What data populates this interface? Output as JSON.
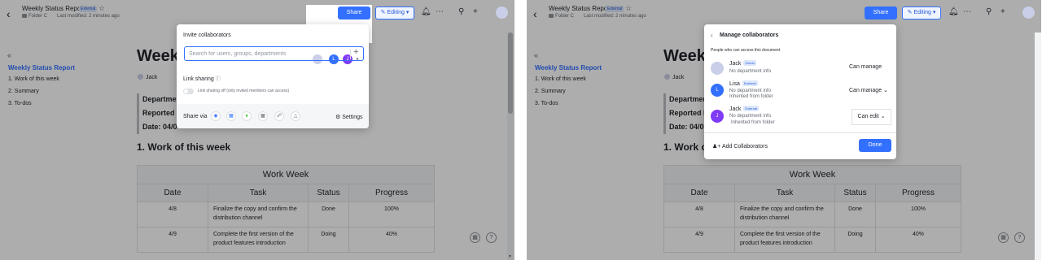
{
  "header": {
    "doc_title": "Weekly Status Report",
    "external_tag": "External",
    "folder": "Folder C",
    "last_modified": "Last modified: 2 minutes ago",
    "share_label": "Share",
    "editing_label": "Editing"
  },
  "toc": {
    "title": "Weekly Status Report",
    "items": [
      "1. Work of this week",
      "2. Summary",
      "3. To-dos"
    ]
  },
  "doc": {
    "big_title": "Week",
    "author": "Jack",
    "meta": [
      "Departmen",
      "Reported b",
      "Date: 04/0"
    ],
    "meta_right": [
      "Departmen",
      "Reported b",
      "Date: 04/0"
    ],
    "section_heading": "1. Work of this week",
    "section_heading_right": "1. Work o",
    "table": {
      "title": "Work Week",
      "headers": [
        "Date",
        "Task",
        "Status",
        "Progress"
      ],
      "rows": [
        [
          "4/8",
          "Finalize the copy and confirm the distribution channel",
          "Done",
          "100%"
        ],
        [
          "4/9",
          "Complete the first version of the product features introduction",
          "Doing",
          "40%"
        ]
      ]
    }
  },
  "invite": {
    "title": "Invite collaborators",
    "search_placeholder": "Search for users, groups, departments",
    "link_sharing": "Link sharing",
    "link_sharing_status": "Link sharing off (only invited members can access)",
    "share_via": "Share via",
    "settings": "Settings",
    "avatars": [
      "L",
      "J"
    ]
  },
  "manage": {
    "title": "Manage collaborators",
    "subtitle": "People who can access this document",
    "people": [
      {
        "name": "Jack",
        "tag": "Owner",
        "info": "No department info",
        "inherit": "",
        "perm": "Can manage",
        "initial": "",
        "color": "#c9cfe8"
      },
      {
        "name": "Lisa",
        "tag": "External",
        "info": "No department info",
        "inherit": "Inherited from folder",
        "perm": "Can manage",
        "initial": "L",
        "color": "#3370ff"
      },
      {
        "name": "Jack",
        "tag": "External",
        "info": "No department info",
        "inherit": "Inherited from folder",
        "perm": "Can edit",
        "initial": "J",
        "color": "#7f3bf5"
      }
    ],
    "add_collaborators": "Add Collaborators",
    "done": "Done"
  }
}
